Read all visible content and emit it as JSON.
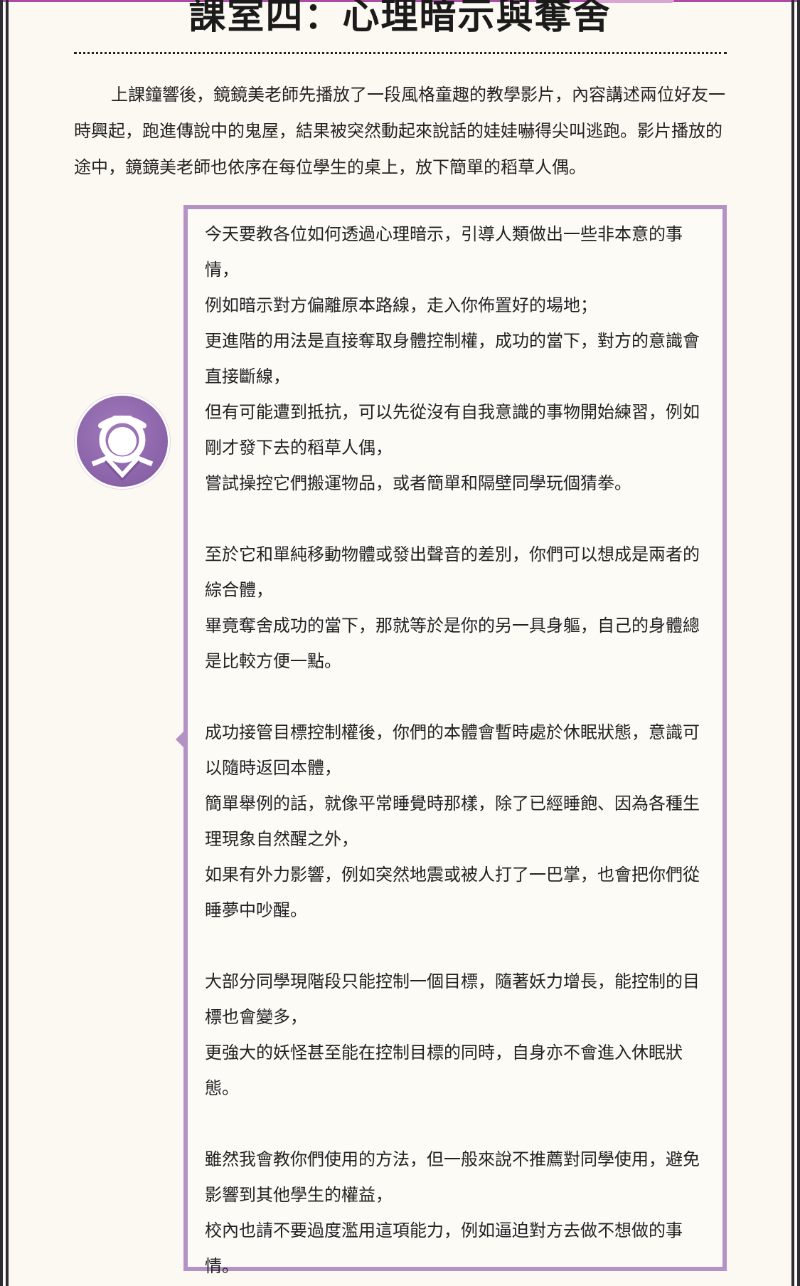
{
  "page": {
    "title": "課室四：心理暗示與奪舍",
    "intro": "上課鐘響後，鏡鏡美老師先播放了一段風格童趣的教學影片，內容講述兩位好友一時興起，跑進傳說中的鬼屋，結果被突然動起來說話的娃娃嚇得尖叫逃跑。影片播放的途中，鏡鏡美老師也依序在每位學生的桌上，放下簡單的稻草人偶。"
  },
  "speaker": {
    "avatar_icon": "masked-figure-icon",
    "accent_color": "#b492c4",
    "avatar_color": "#8a62a8"
  },
  "speech": {
    "paragraphs": [
      {
        "lines": [
          "今天要教各位如何透過心理暗示，引導人類做出一些非本意的事情，",
          "例如暗示對方偏離原本路線，走入你佈置好的場地；",
          "更進階的用法是直接奪取身體控制權，成功的當下，對方的意識會直接斷線，",
          "但有可能遭到抵抗，可以先從沒有自我意識的事物開始練習，例如剛才發下去的稻草人偶，",
          "嘗試操控它們搬運物品，或者簡單和隔壁同學玩個猜拳。"
        ]
      },
      {
        "lines": [
          "至於它和單純移動物體或發出聲音的差別，你們可以想成是兩者的綜合體，",
          "畢竟奪舍成功的當下，那就等於是你的另一具身軀，自己的身體總是比較方便一點。"
        ]
      },
      {
        "lines": [
          "成功接管目標控制權後，你們的本體會暫時處於休眠狀態，意識可以隨時返回本體，",
          "簡單舉例的話，就像平常睡覺時那樣，除了已經睡飽、因為各種生理現象自然醒之外，",
          "如果有外力影響，例如突然地震或被人打了一巴掌，也會把你們從睡夢中吵醒。"
        ]
      },
      {
        "lines": [
          "大部分同學現階段只能控制一個目標，隨著妖力增長，能控制的目標也會變多，",
          "更強大的妖怪甚至能在控制目標的同時，自身亦不會進入休眠狀態。"
        ]
      },
      {
        "lines": [
          "雖然我會教你們使用的方法，但一般來說不推薦對同學使用，避免影響到其他學生的權益，",
          "校內也請不要過度濫用這項能力，例如逼迫對方去做不想做的事情。"
        ]
      }
    ]
  }
}
